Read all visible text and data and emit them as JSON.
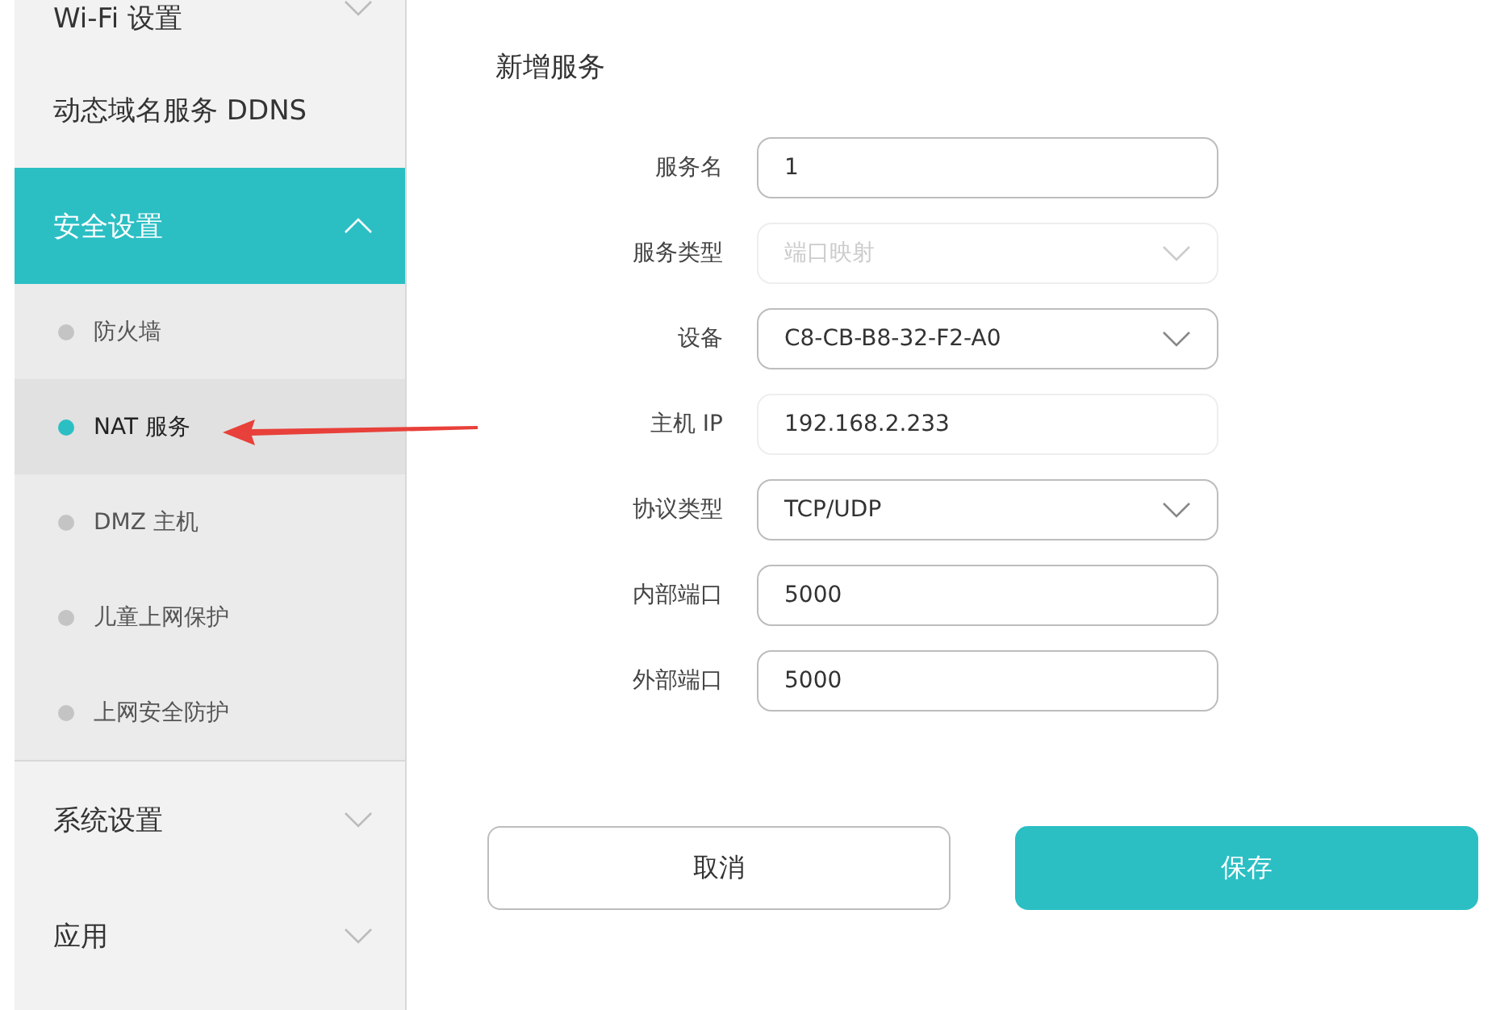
{
  "sidebar": {
    "items": [
      {
        "label": "Wi-Fi 设置",
        "expanded": false,
        "selected": false
      },
      {
        "label": "动态域名服务 DDNS",
        "selected": false
      },
      {
        "label": "安全设置",
        "expanded": true,
        "selected": true,
        "children": [
          {
            "label": "防火墙",
            "selected": false
          },
          {
            "label": "NAT 服务",
            "selected": true
          },
          {
            "label": "DMZ 主机",
            "selected": false
          },
          {
            "label": "儿童上网保护",
            "selected": false
          },
          {
            "label": "上网安全防护",
            "selected": false
          }
        ]
      },
      {
        "label": "系统设置",
        "expanded": false,
        "selected": false
      },
      {
        "label": "应用",
        "expanded": false,
        "selected": false
      }
    ]
  },
  "form": {
    "title": "新增服务",
    "fields": [
      {
        "label": "服务名",
        "kind": "text",
        "value": "1",
        "disabled": false
      },
      {
        "label": "服务类型",
        "kind": "select",
        "value": "端口映射",
        "disabled": true
      },
      {
        "label": "设备",
        "kind": "select",
        "value": "C8-CB-B8-32-F2-A0",
        "disabled": false
      },
      {
        "label": "主机 IP",
        "kind": "text",
        "value": "192.168.2.233",
        "disabled": true
      },
      {
        "label": "协议类型",
        "kind": "select",
        "value": "TCP/UDP",
        "disabled": false
      },
      {
        "label": "内部端口",
        "kind": "text",
        "value": "5000",
        "disabled": false
      },
      {
        "label": "外部端口",
        "kind": "text",
        "value": "5000",
        "disabled": false
      }
    ],
    "buttons": [
      {
        "label": "取消",
        "kind": "secondary"
      },
      {
        "label": "保存",
        "kind": "primary"
      }
    ]
  }
}
